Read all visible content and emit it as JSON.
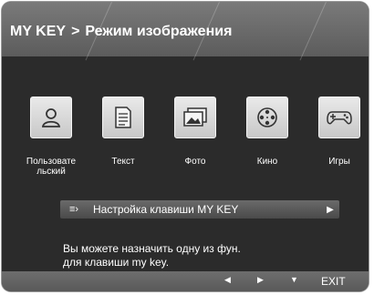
{
  "header": {
    "parent": "MY KEY",
    "separator": ">",
    "title": "Режим изображения"
  },
  "modes": [
    {
      "id": "user",
      "label": "Пользовате льский",
      "icon": "person-icon"
    },
    {
      "id": "text",
      "label": "Текст",
      "icon": "document-icon"
    },
    {
      "id": "photo",
      "label": "Фото",
      "icon": "photo-icon"
    },
    {
      "id": "cinema",
      "label": "Кино",
      "icon": "film-reel-icon"
    },
    {
      "id": "games",
      "label": "Игры",
      "icon": "gamepad-icon"
    }
  ],
  "setting": {
    "label": "Настройка клавиши MY KEY",
    "arrow": "▶"
  },
  "description": {
    "line1": "Вы можете назначить одну из фун.",
    "line2": "для клавиши my key."
  },
  "footer": {
    "left": "◀",
    "right": "▶",
    "down": "▼",
    "exit": "EXIT"
  },
  "colors": {
    "background": "#2b2b2b",
    "header": "#6a6a6a",
    "tile": "#d8d8d8",
    "text": "#ffffff"
  }
}
